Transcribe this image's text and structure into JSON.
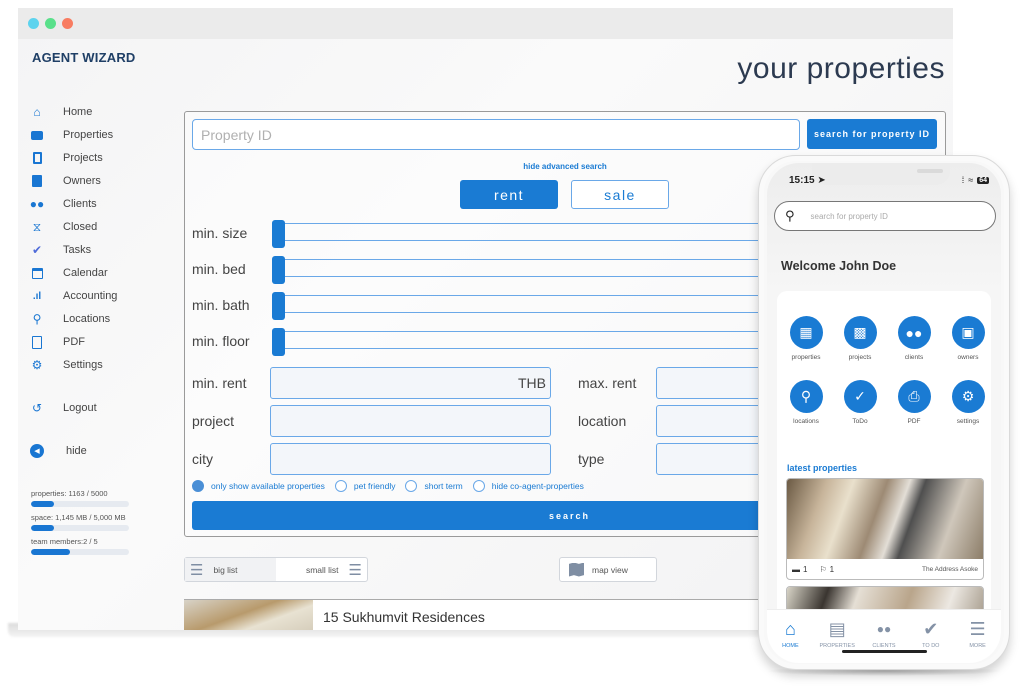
{
  "window": {
    "traffic_lights": [
      {
        "name": "close",
        "color": "#5dd3ee"
      },
      {
        "name": "minimize",
        "color": "#59e08a"
      },
      {
        "name": "maximize",
        "color": "#f87c61"
      }
    ]
  },
  "brand": {
    "logo": "AGENT WIZARD",
    "accent": "#1a7bd3"
  },
  "sidebar": {
    "items": [
      {
        "label": "Home",
        "icon": "home-icon"
      },
      {
        "label": "Properties",
        "icon": "briefcase-icon"
      },
      {
        "label": "Projects",
        "icon": "building-icon"
      },
      {
        "label": "Owners",
        "icon": "owner-tie-icon"
      },
      {
        "label": "Clients",
        "icon": "users-icon"
      },
      {
        "label": "Closed",
        "icon": "handshake-icon"
      },
      {
        "label": "Tasks",
        "icon": "check-icon"
      },
      {
        "label": "Calendar",
        "icon": "calendar-icon"
      },
      {
        "label": "Accounting",
        "icon": "bar-chart-icon"
      },
      {
        "label": "Locations",
        "icon": "map-pin-icon"
      },
      {
        "label": "PDF",
        "icon": "pdf-icon"
      },
      {
        "label": "Settings",
        "icon": "gear-icon"
      }
    ],
    "logout": "Logout",
    "hide": "hide",
    "usage": [
      {
        "label": "properties: 1163 / 5000",
        "percent": 23
      },
      {
        "label": "space: 1,145 MB / 5,000 MB",
        "percent": 23
      },
      {
        "label": "team members:2 / 5",
        "percent": 40
      }
    ]
  },
  "main": {
    "title": "your properties",
    "property_id_placeholder": "Property ID",
    "search_id_button": "search for property ID",
    "advanced_toggle": "hide advanced search",
    "mode": {
      "rent": "rent",
      "sale": "sale",
      "selected": "rent"
    },
    "sliders": [
      {
        "label": "min. size",
        "value": 0
      },
      {
        "label": "min. bed",
        "value": 0
      },
      {
        "label": "min. bath",
        "value": 0
      },
      {
        "label": "min. floor",
        "value": 0
      }
    ],
    "fields_left": [
      {
        "label": "min. rent",
        "value": "THB"
      },
      {
        "label": "project",
        "value": ""
      },
      {
        "label": "city",
        "value": ""
      }
    ],
    "fields_right": [
      {
        "label": "max. rent",
        "value": ""
      },
      {
        "label": "location",
        "value": ""
      },
      {
        "label": "type",
        "value": ""
      }
    ],
    "checks": [
      {
        "label": "only show available properties",
        "checked": true
      },
      {
        "label": "pet friendly",
        "checked": false
      },
      {
        "label": "short term",
        "checked": false
      },
      {
        "label": "hide co-agent-properties",
        "checked": false
      }
    ],
    "search_button": "search",
    "views": {
      "big_list": "big list",
      "small_list": "small list",
      "map_view": "map view"
    },
    "listings": [
      {
        "name": "15 Sukhumvit Residences"
      }
    ]
  },
  "phone": {
    "time": "15:15",
    "battery": "64",
    "search_placeholder": "search for property ID",
    "welcome": "Welcome John Doe",
    "grid": [
      {
        "label": "properties",
        "icon": "building-icon"
      },
      {
        "label": "projects",
        "icon": "tower-icon"
      },
      {
        "label": "clients",
        "icon": "users-icon"
      },
      {
        "label": "owners",
        "icon": "owner-tie-icon"
      },
      {
        "label": "locations",
        "icon": "map-pin-icon"
      },
      {
        "label": "ToDo",
        "icon": "check-circle-icon"
      },
      {
        "label": "PDF",
        "icon": "pdf-icon"
      },
      {
        "label": "settings",
        "icon": "gear-icon"
      }
    ],
    "latest_title": "latest properties",
    "latest": [
      {
        "beds": "1",
        "baths": "1",
        "location": "The Address Asoke"
      }
    ],
    "tabs": [
      {
        "label": "HOME",
        "active": true
      },
      {
        "label": "PROPERTIES",
        "active": false
      },
      {
        "label": "CLIENTS",
        "active": false
      },
      {
        "label": "TO DO",
        "active": false
      },
      {
        "label": "MORE",
        "active": false
      }
    ]
  }
}
